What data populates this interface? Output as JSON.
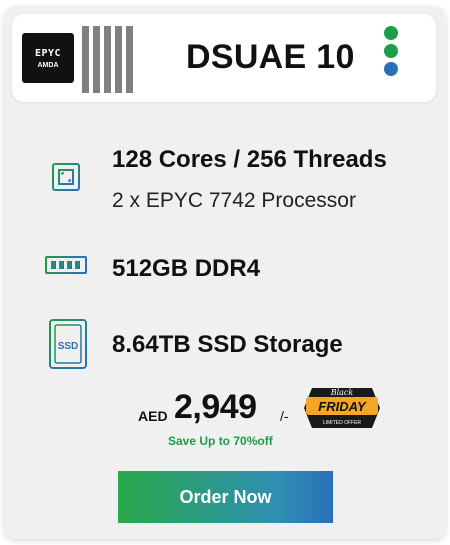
{
  "header": {
    "cpu_badge": {
      "line1": "EPYC",
      "line2": "AMDA"
    },
    "title": "DSUAE 10",
    "status_dot_colors": [
      "#1e9c4a",
      "#1e9c4a",
      "#2a6fba"
    ]
  },
  "specs": {
    "cpu": {
      "icon": "processor-chip-icon",
      "main": "128 Cores / 256 Threads",
      "sub": "2 x EPYC 7742 Processor"
    },
    "ram": {
      "icon": "memory-module-icon",
      "main": "512GB DDR4"
    },
    "storage": {
      "icon": "ssd-drive-icon",
      "icon_label": "SSD",
      "main": "8.64TB SSD Storage"
    }
  },
  "price": {
    "currency": "AED",
    "amount": "2,949",
    "suffix": "/-",
    "savings": "Save Up to 70%off"
  },
  "promo_badge": {
    "line1": "Black",
    "line2": "FRIDAY",
    "line3": "LIMITED OFFER"
  },
  "cta": {
    "label": "Order Now"
  },
  "colors": {
    "accent_green": "#1e9c4a",
    "accent_blue": "#2a6fba",
    "badge_orange": "#f5a623"
  }
}
